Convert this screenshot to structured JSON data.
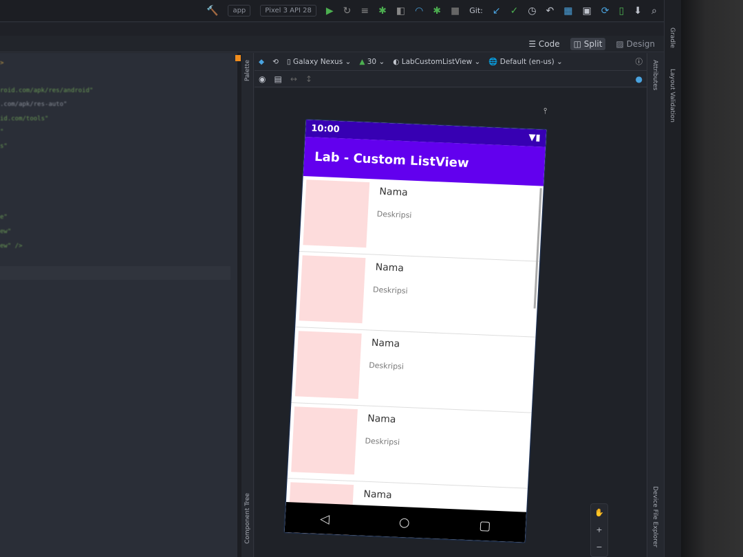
{
  "toolbar": {
    "config": "app",
    "device": "Pixel 3 API 28",
    "git_label": "Git:"
  },
  "mode": {
    "code": "Code",
    "split": "Split",
    "design": "Design"
  },
  "editor": {
    "lines": [
      ">",
      "roid.com/apk/res/android\"",
      ".com/apk/res-auto\"",
      "id.com/tools\"",
      "\"",
      "s\"",
      "e\"",
      "ew\"",
      "ew\" />"
    ]
  },
  "design_toolbar": {
    "device": "Galaxy Nexus",
    "api": "30",
    "theme": "LabCustomListView",
    "locale": "Default (en-us)"
  },
  "side_panels": {
    "palette": "Palette",
    "component_tree": "Component Tree",
    "attributes": "Attributes",
    "layout_validation": "Layout Validation",
    "gradle": "Gradle",
    "device_file_explorer": "Device File Explorer"
  },
  "phone": {
    "time": "10:00",
    "app_title": "Lab - Custom ListView",
    "items": [
      {
        "name": "Nama",
        "desc": "Deskripsi"
      },
      {
        "name": "Nama",
        "desc": "Deskripsi"
      },
      {
        "name": "Nama",
        "desc": "Deskripsi"
      },
      {
        "name": "Nama",
        "desc": "Deskripsi"
      },
      {
        "name": "Nama",
        "desc": ""
      }
    ],
    "colors": {
      "status_bar": "#3700b3",
      "app_bar": "#6200ee",
      "placeholder": "#fddcdc"
    }
  }
}
